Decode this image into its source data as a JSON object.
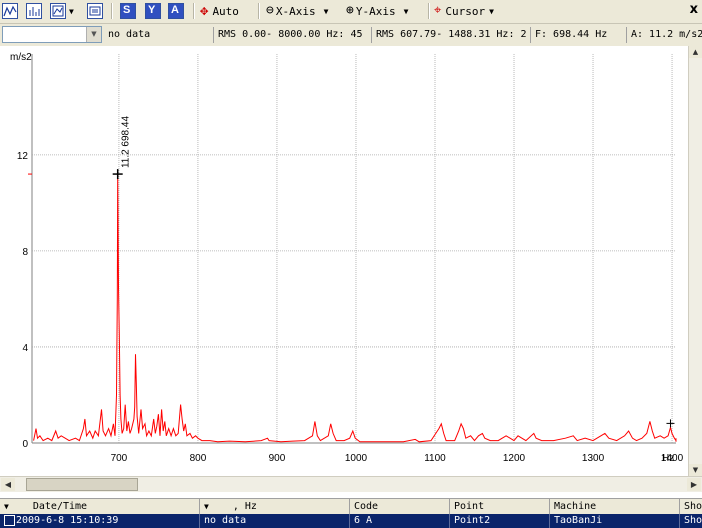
{
  "toolbar": {
    "auto_label": "Auto",
    "x_axis_label": "X-Axis",
    "y_axis_label": "Y-Axis",
    "cursor_label": "Cursor",
    "close_glyph": "x"
  },
  "status": {
    "combo_value": "",
    "no_data": "no data",
    "rms_full": "RMS 0.00- 8000.00 Hz: 45",
    "rms_band": "RMS 607.79- 1488.31 Hz: 2",
    "frequency": "F: 698.44 Hz",
    "amplitude": "A: 11.2 m/s2"
  },
  "colors": {
    "spectrum": "#ff0000",
    "grid": "#a8a8a8",
    "selection": "#0a246a"
  },
  "chart_data": {
    "type": "line",
    "ylabel": "m/s2",
    "xlabel": "Hz",
    "xlim": [
      590,
      1405
    ],
    "ylim": [
      0,
      16.2
    ],
    "xticks": [
      700,
      800,
      900,
      1000,
      1100,
      1200,
      1300,
      1400
    ],
    "yticks": [
      0,
      4,
      8,
      12
    ],
    "grid": true,
    "peak_marker": {
      "x": 698.44,
      "y": 11.2,
      "label": "11.2  698.44"
    },
    "secondary_marker": {
      "x": 1398,
      "y": 0.65
    },
    "series": [
      {
        "points": [
          [
            592,
            0.1
          ],
          [
            595,
            0.6
          ],
          [
            597,
            0.2
          ],
          [
            600,
            0.3
          ],
          [
            604,
            0.1
          ],
          [
            610,
            0.2
          ],
          [
            615,
            0.1
          ],
          [
            620,
            0.5
          ],
          [
            623,
            0.2
          ],
          [
            627,
            0.3
          ],
          [
            632,
            0.2
          ],
          [
            637,
            0.1
          ],
          [
            645,
            0.2
          ],
          [
            650,
            0.1
          ],
          [
            655,
            0.6
          ],
          [
            657,
            1.0
          ],
          [
            659,
            0.3
          ],
          [
            663,
            0.5
          ],
          [
            667,
            0.2
          ],
          [
            670,
            0.5
          ],
          [
            674,
            0.3
          ],
          [
            678,
            1.4
          ],
          [
            680,
            0.5
          ],
          [
            683,
            0.3
          ],
          [
            687,
            0.6
          ],
          [
            690,
            0.3
          ],
          [
            693,
            0.8
          ],
          [
            695,
            0.3
          ],
          [
            697,
            2.0
          ],
          [
            698,
            6.0
          ],
          [
            698.44,
            11.2
          ],
          [
            699.5,
            6.5
          ],
          [
            700.5,
            4.5
          ],
          [
            701.5,
            2.0
          ],
          [
            702.5,
            1.0
          ],
          [
            704,
            0.4
          ],
          [
            706,
            0.6
          ],
          [
            708,
            1.6
          ],
          [
            710,
            0.5
          ],
          [
            712,
            0.9
          ],
          [
            714,
            0.4
          ],
          [
            716,
            0.6
          ],
          [
            719,
            1.0
          ],
          [
            720,
            1.5
          ],
          [
            721,
            3.7
          ],
          [
            722,
            2.5
          ],
          [
            723,
            1.1
          ],
          [
            725,
            0.4
          ],
          [
            728,
            1.4
          ],
          [
            730,
            0.6
          ],
          [
            733,
            0.8
          ],
          [
            735,
            0.3
          ],
          [
            738,
            0.5
          ],
          [
            741,
            0.3
          ],
          [
            744,
            1.0
          ],
          [
            746,
            0.4
          ],
          [
            748,
            0.7
          ],
          [
            750,
            1.2
          ],
          [
            752,
            0.3
          ],
          [
            754,
            1.4
          ],
          [
            756,
            0.5
          ],
          [
            758,
            0.9
          ],
          [
            760,
            0.3
          ],
          [
            763,
            0.6
          ],
          [
            766,
            0.3
          ],
          [
            769,
            0.6
          ],
          [
            772,
            0.3
          ],
          [
            775,
            0.4
          ],
          [
            778,
            1.6
          ],
          [
            780,
            1.0
          ],
          [
            782,
            0.5
          ],
          [
            784,
            0.8
          ],
          [
            786,
            0.3
          ],
          [
            790,
            0.4
          ],
          [
            793,
            0.2
          ],
          [
            797,
            0.3
          ],
          [
            800,
            0.2
          ],
          [
            805,
            0.1
          ],
          [
            815,
            0.1
          ],
          [
            825,
            0.05
          ],
          [
            840,
            0.08
          ],
          [
            860,
            0.05
          ],
          [
            880,
            0.1
          ],
          [
            888,
            0.2
          ],
          [
            890,
            0.1
          ],
          [
            905,
            0.05
          ],
          [
            920,
            0.08
          ],
          [
            935,
            0.1
          ],
          [
            945,
            0.3
          ],
          [
            948,
            0.9
          ],
          [
            951,
            0.3
          ],
          [
            955,
            0.1
          ],
          [
            965,
            0.3
          ],
          [
            968,
            0.8
          ],
          [
            971,
            0.4
          ],
          [
            975,
            0.1
          ],
          [
            985,
            0.1
          ],
          [
            992,
            0.2
          ],
          [
            996,
            0.5
          ],
          [
            999,
            0.2
          ],
          [
            1005,
            0.05
          ],
          [
            1020,
            0.05
          ],
          [
            1040,
            0.05
          ],
          [
            1060,
            0.05
          ],
          [
            1075,
            0.15
          ],
          [
            1080,
            0.05
          ],
          [
            1095,
            0.1
          ],
          [
            1105,
            0.6
          ],
          [
            1108,
            0.8
          ],
          [
            1111,
            0.4
          ],
          [
            1114,
            0.1
          ],
          [
            1125,
            0.1
          ],
          [
            1130,
            0.5
          ],
          [
            1133,
            0.8
          ],
          [
            1136,
            0.6
          ],
          [
            1139,
            0.2
          ],
          [
            1145,
            0.3
          ],
          [
            1150,
            0.1
          ],
          [
            1155,
            0.3
          ],
          [
            1160,
            0.4
          ],
          [
            1163,
            0.2
          ],
          [
            1170,
            0.1
          ],
          [
            1180,
            0.1
          ],
          [
            1190,
            0.3
          ],
          [
            1195,
            0.2
          ],
          [
            1200,
            0.1
          ],
          [
            1205,
            0.3
          ],
          [
            1210,
            0.2
          ],
          [
            1215,
            0.1
          ],
          [
            1225,
            0.4
          ],
          [
            1228,
            0.2
          ],
          [
            1235,
            0.1
          ],
          [
            1250,
            0.1
          ],
          [
            1265,
            0.2
          ],
          [
            1275,
            0.3
          ],
          [
            1280,
            0.1
          ],
          [
            1290,
            0.2
          ],
          [
            1300,
            0.1
          ],
          [
            1310,
            0.3
          ],
          [
            1315,
            0.4
          ],
          [
            1320,
            0.2
          ],
          [
            1330,
            0.1
          ],
          [
            1340,
            0.3
          ],
          [
            1345,
            0.5
          ],
          [
            1350,
            0.2
          ],
          [
            1355,
            0.1
          ],
          [
            1362,
            0.2
          ],
          [
            1368,
            0.4
          ],
          [
            1372,
            0.9
          ],
          [
            1375,
            0.5
          ],
          [
            1378,
            0.2
          ],
          [
            1385,
            0.3
          ],
          [
            1390,
            0.2
          ],
          [
            1395,
            0.3
          ],
          [
            1398,
            0.65
          ],
          [
            1400,
            0.4
          ],
          [
            1403,
            0.2
          ],
          [
            1410,
            0.1
          ],
          [
            1420,
            0.1
          ],
          [
            1430,
            0.05
          ],
          [
            1440,
            0.2
          ],
          [
            1445,
            0.1
          ],
          [
            1455,
            0.05
          ],
          [
            1465,
            0.1
          ],
          [
            1470,
            0.2
          ],
          [
            1475,
            0.1
          ],
          [
            1480,
            0.05
          ],
          [
            1488,
            0.05
          ]
        ]
      }
    ]
  },
  "table": {
    "headers": [
      ", Hz",
      "Code",
      "Point",
      "Machine",
      "Sho"
    ],
    "date_header": "Date/Time",
    "row": [
      "2009-6-8 15:10:39",
      "no data",
      "6 A",
      "Point2",
      "TaoBanJi",
      "Sho"
    ]
  }
}
